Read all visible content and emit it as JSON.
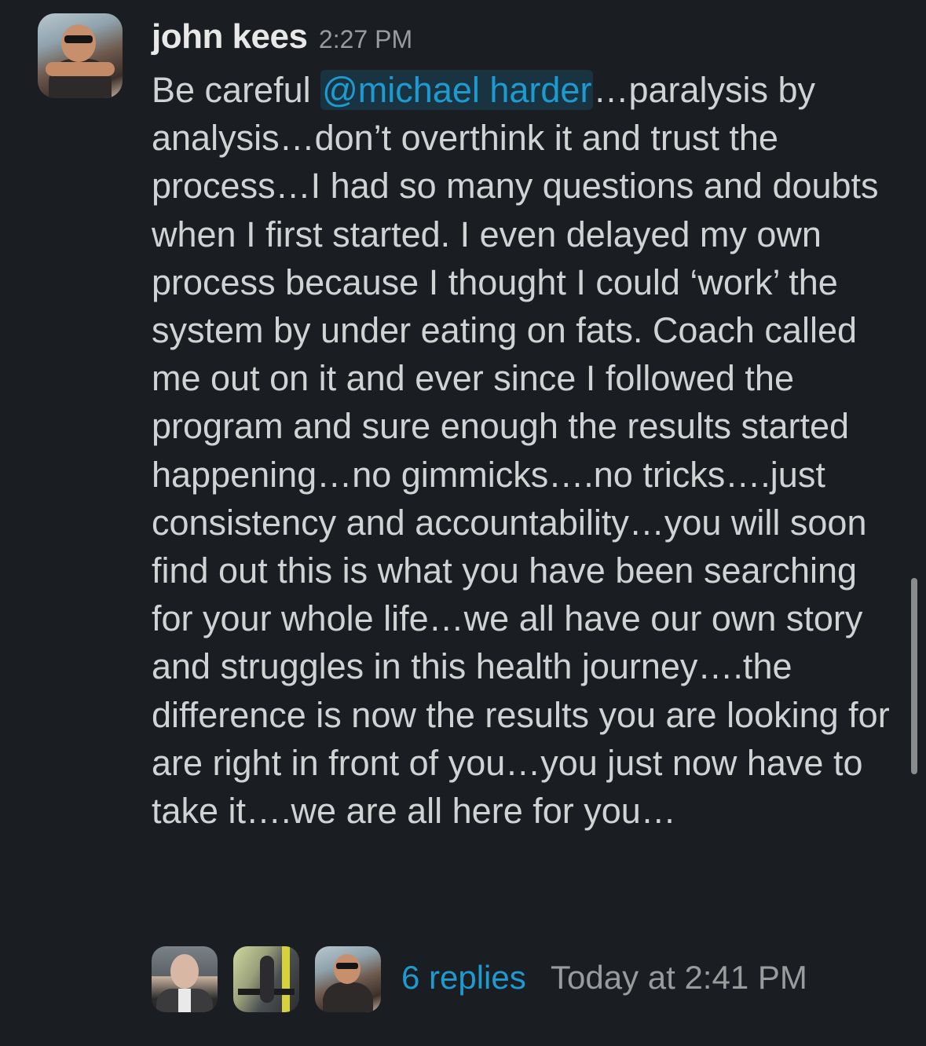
{
  "message": {
    "author": "john kees",
    "timestamp": "2:27 PM",
    "mention": "@michael harder",
    "text_before_mention": "Be careful ",
    "text_after_mention": "…paralysis by analysis…don’t overthink it and trust the process…I had so many questions and doubts when I first started. I even delayed my own process because I thought I could ‘work’ the system by under eating on fats. Coach called me out on it and ever since I followed the program and sure enough the results started happening…no gimmicks….no tricks….just consistency and accountability…you will soon find out this is what you have been searching for your whole life…we all have our own story and struggles in this health journey….the difference is now the results you are looking for are right in front of you…you just now have to take it….we are all here for you…"
  },
  "thread": {
    "reply_count": "6 replies",
    "last_reply": "Today at 2:41 PM"
  },
  "colors": {
    "background": "#1a1d21",
    "text": "#d1d2d3",
    "link": "#1d9bd1",
    "muted": "#9a9b9d"
  }
}
